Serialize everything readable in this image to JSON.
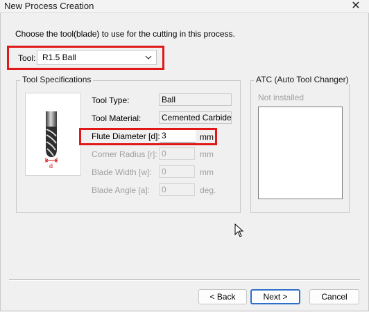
{
  "window": {
    "title": "New Process Creation",
    "close_glyph": "✕"
  },
  "instruction": "Choose the tool(blade) to use for the cutting in this process.",
  "tool": {
    "label": "Tool:",
    "selected": "R1.5 Ball"
  },
  "specs": {
    "legend": "Tool Specifications",
    "tool_type": {
      "label": "Tool Type:",
      "value": "Ball"
    },
    "tool_material": {
      "label": "Tool Material:",
      "value": "Cemented Carbide"
    },
    "flute_diameter": {
      "label": "Flute Diameter [d]:",
      "value": "3",
      "unit": "mm"
    },
    "corner_radius": {
      "label": "Corner Radius [r]:",
      "value": "0",
      "unit": "mm"
    },
    "blade_width": {
      "label": "Blade Width [w]:",
      "value": "0",
      "unit": "mm"
    },
    "blade_angle": {
      "label": "Blade Angle [a]:",
      "value": "0",
      "unit": "deg."
    },
    "diagram_label": "d"
  },
  "atc": {
    "legend": "ATC (Auto Tool Changer)",
    "status": "Not installed"
  },
  "buttons": {
    "back": "< Back",
    "next": "Next >",
    "cancel": "Cancel"
  },
  "colors": {
    "highlight": "#e01818",
    "default_button_border": "#2f6fc8"
  }
}
